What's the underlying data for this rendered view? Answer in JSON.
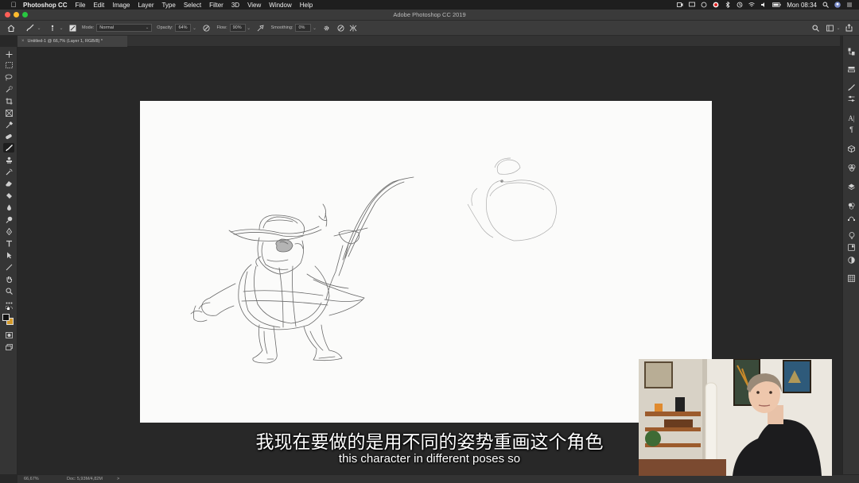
{
  "menubar": {
    "app_name": "Photoshop CC",
    "items": [
      "File",
      "Edit",
      "Image",
      "Layer",
      "Type",
      "Select",
      "Filter",
      "3D",
      "View",
      "Window",
      "Help"
    ],
    "clock": "Mon 08:34"
  },
  "window": {
    "title": "Adobe Photoshop CC 2019"
  },
  "options": {
    "mode_label": "Mode:",
    "mode_value": "Normal",
    "opacity_label": "Opacity:",
    "opacity_value": "64%",
    "flow_label": "Flow:",
    "flow_value": "90%",
    "smoothing_label": "Smoothing:",
    "smoothing_value": "0%"
  },
  "document": {
    "tab_label": "Untitled-1 @ 66,7% (Layer 1, RGB/8) *",
    "tab_close": "×"
  },
  "status": {
    "zoom": "66,67%",
    "doc_info": "Doc: 5,93M/4,82M",
    "arrow": ">"
  },
  "subtitles": {
    "zh": "我现在要做的是用不同的姿势重画这个角色",
    "en": "this character in different poses so"
  },
  "colors": {
    "foreground": "#111111",
    "background": "#d49a2b",
    "close": "#ff5f57",
    "minimize": "#febc2e",
    "maximize": "#28c840"
  }
}
